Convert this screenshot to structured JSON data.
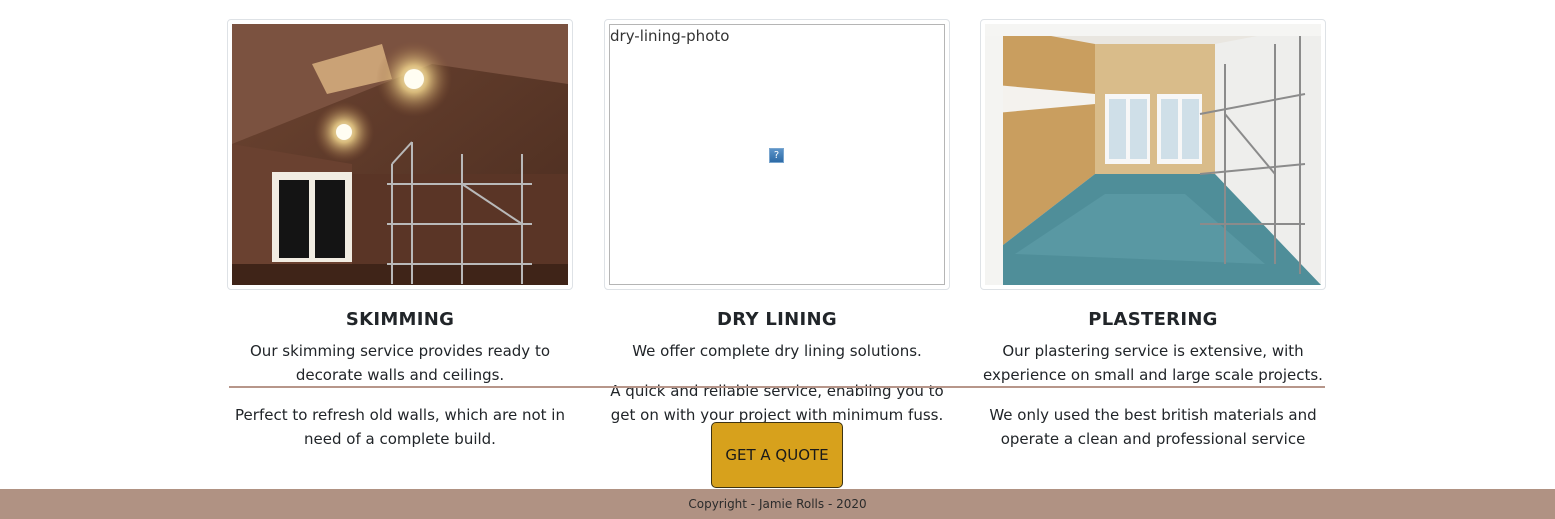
{
  "services": [
    {
      "title": "SKIMMING",
      "paragraphs": [
        "Our skimming service provides ready to decorate walls and ceilings.",
        "Perfect to refresh old walls, which are not in need of a complete build."
      ]
    },
    {
      "title": "DRY LINING",
      "image_alt": "dry-lining-photo",
      "broken_icon_glyph": "?",
      "paragraphs": [
        "We offer complete dry lining solutions.",
        "A quick and reliable service, enabling you to get on with your project with minimum fuss."
      ]
    },
    {
      "title": "PLASTERING",
      "paragraphs": [
        "Our plastering service is extensive, with experience on small and large scale projects.",
        "We only used the best british materials and operate a clean and professional service"
      ]
    }
  ],
  "cta": {
    "label": "GET A QUOTE"
  },
  "footer": {
    "copyright": "Copyright - Jamie Rolls - 2020"
  },
  "colors": {
    "button": "#d7a11c",
    "footer": "#b09283",
    "divider": "#b7968a"
  }
}
